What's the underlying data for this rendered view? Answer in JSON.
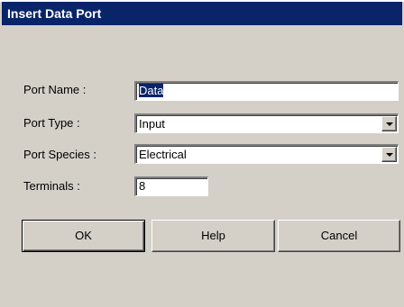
{
  "dialog": {
    "title": "Insert Data Port"
  },
  "fields": {
    "port_name_label": "Port Name :",
    "port_name_value": "Data",
    "port_type_label": "Port Type :",
    "port_type_value": "Input",
    "port_species_label": "Port Species :",
    "port_species_value": "Electrical",
    "terminals_label": "Terminals :",
    "terminals_value": "8"
  },
  "buttons": {
    "ok": "OK",
    "help": "Help",
    "cancel": "Cancel"
  },
  "icons": {
    "dropdown": "chevron-down-icon"
  },
  "colors": {
    "titlebar": "#0a246a",
    "face": "#d4d0c8",
    "selection": "#0a246a"
  }
}
